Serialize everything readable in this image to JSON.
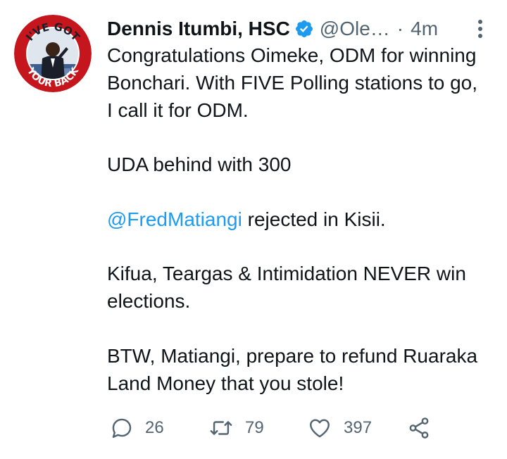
{
  "tweet": {
    "author_name": "Dennis Itumbi, HSC",
    "handle": "@Ole…",
    "separator": "·",
    "time": "4m",
    "avatar_text_top": "I'VE GOT",
    "avatar_text_bottom": "YOUR BACK",
    "paragraphs": [
      "Congratulations Oimeke, ODM for winning Bonchari. With FIVE Polling stations to go, I call it for ODM.",
      "UDA behind with 300",
      "Kifua, Teargas & Intimidation NEVER win elections.",
      "BTW, Matiangi, prepare to refund Ruaraka Land Money that you stole!"
    ],
    "mention": "@FredMatiangi",
    "mention_suffix": " rejected in Kisii."
  },
  "actions": {
    "reply_count": "26",
    "retweet_count": "79",
    "like_count": "397"
  },
  "icons": {
    "verified": "verified-badge-icon",
    "more": "more-vertical-icon",
    "reply": "reply-icon",
    "retweet": "retweet-icon",
    "like": "heart-icon",
    "share": "share-icon"
  },
  "colors": {
    "text": "#0f1419",
    "secondary": "#536471",
    "link": "#1d9bf0",
    "avatar_ring": "#c4161c"
  }
}
